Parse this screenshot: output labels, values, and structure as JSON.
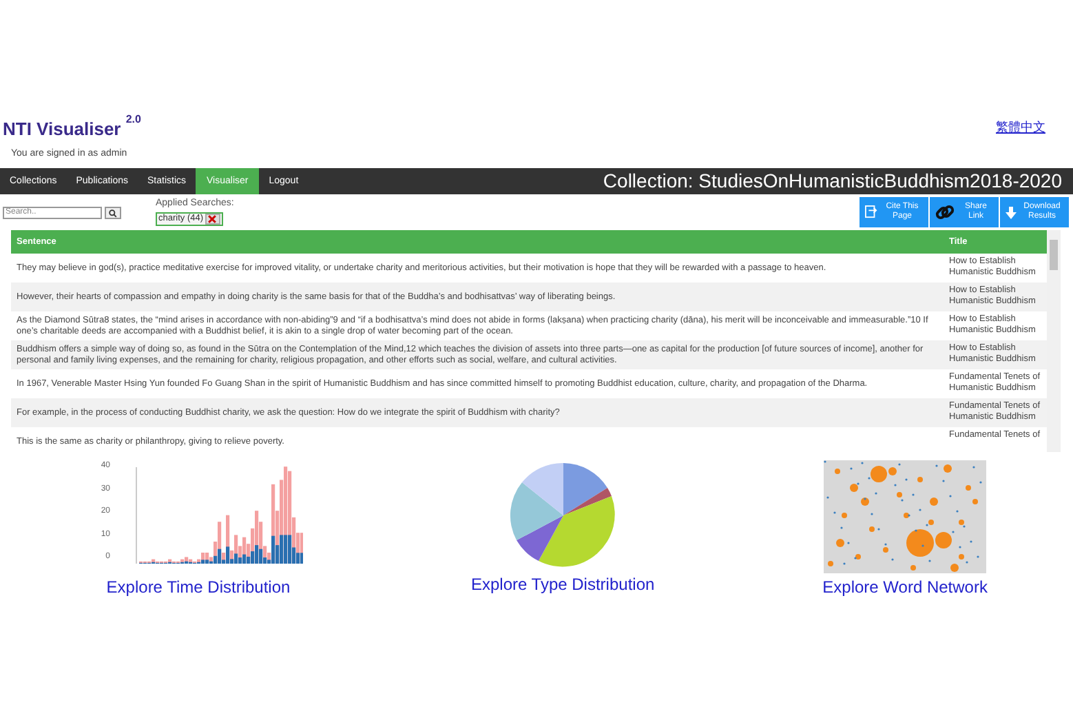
{
  "app": {
    "title": "NTI Visualiser",
    "version": "2.0",
    "language_link": "繁體中文",
    "signed_in": "You are signed in as admin"
  },
  "nav": {
    "items": [
      {
        "label": "Collections",
        "selected": false
      },
      {
        "label": "Publications",
        "selected": false
      },
      {
        "label": "Statistics",
        "selected": false
      },
      {
        "label": "Visualiser",
        "selected": true
      },
      {
        "label": "Logout",
        "selected": false
      }
    ],
    "collection": "Collection: StudiesOnHumanisticBuddhism2018-2020"
  },
  "search": {
    "placeholder": "Search..",
    "applied_label": "Applied Searches:",
    "applied": [
      {
        "term": "charity (44)"
      }
    ]
  },
  "actions": [
    {
      "kind": "cite",
      "label": "Cite This Page"
    },
    {
      "kind": "share",
      "label": "Share Link"
    },
    {
      "kind": "download",
      "label": "Download Results"
    }
  ],
  "table": {
    "columns": [
      "Sentence",
      "Title"
    ],
    "rows": [
      [
        "They may believe in god(s), practice meditative exercise for improved vitality, or undertake charity and meritorious activities, but their motivation is hope that they will be rewarded with a passage to heaven.",
        "How to Establish Humanistic Buddhism"
      ],
      [
        "However, their hearts of compassion and empathy in doing charity is the same basis for that of the Buddha’s and bodhisattvas’ way of liberating beings.",
        "How to Establish Humanistic Buddhism"
      ],
      [
        "As the Diamond Sūtra8 states, the “mind arises in accordance with non-abiding”9 and “if a bodhisattva’s mind does not abide in forms (lakṣana) when practicing charity (dāna), his merit will be inconceivable and immeasurable.”10 If one’s charitable deeds are accompanied with a Buddhist belief, it is akin to a single drop of water becoming part of the ocean.",
        "How to Establish Humanistic Buddhism"
      ],
      [
        "Buddhism offers a simple way of doing so, as found in the Sūtra on the Contemplation of the Mind,12 which teaches the division of assets into three parts—one as capital for the production [of future sources of income], another for personal and family living expenses, and the remaining for charity, religious propagation, and other efforts such as social, welfare, and cultural activities.",
        "How to Establish Humanistic Buddhism"
      ],
      [
        "In 1967, Venerable Master Hsing Yun founded Fo Guang Shan in the spirit of Humanistic Buddhism and has since committed himself to promoting Buddhist education, culture, charity, and propagation of the Dharma.",
        "Fundamental Tenets of Humanistic Buddhism"
      ],
      [
        "For example, in the process of conducting Buddhist charity, we ask the question: How do we integrate the spirit of Buddhism with charity?",
        "Fundamental Tenets of Humanistic Buddhism"
      ],
      [
        "This is the same as charity or philanthropy, giving to relieve poverty.",
        "Fundamental Tenets of"
      ]
    ]
  },
  "explore": [
    {
      "kind": "time",
      "label": "Explore Time Distribution",
      "y_ticks": [
        "40",
        "30",
        "20",
        "10",
        "0"
      ]
    },
    {
      "kind": "type",
      "label": "Explore Type Distribution"
    },
    {
      "kind": "network",
      "label": "Explore Word Network"
    }
  ]
}
